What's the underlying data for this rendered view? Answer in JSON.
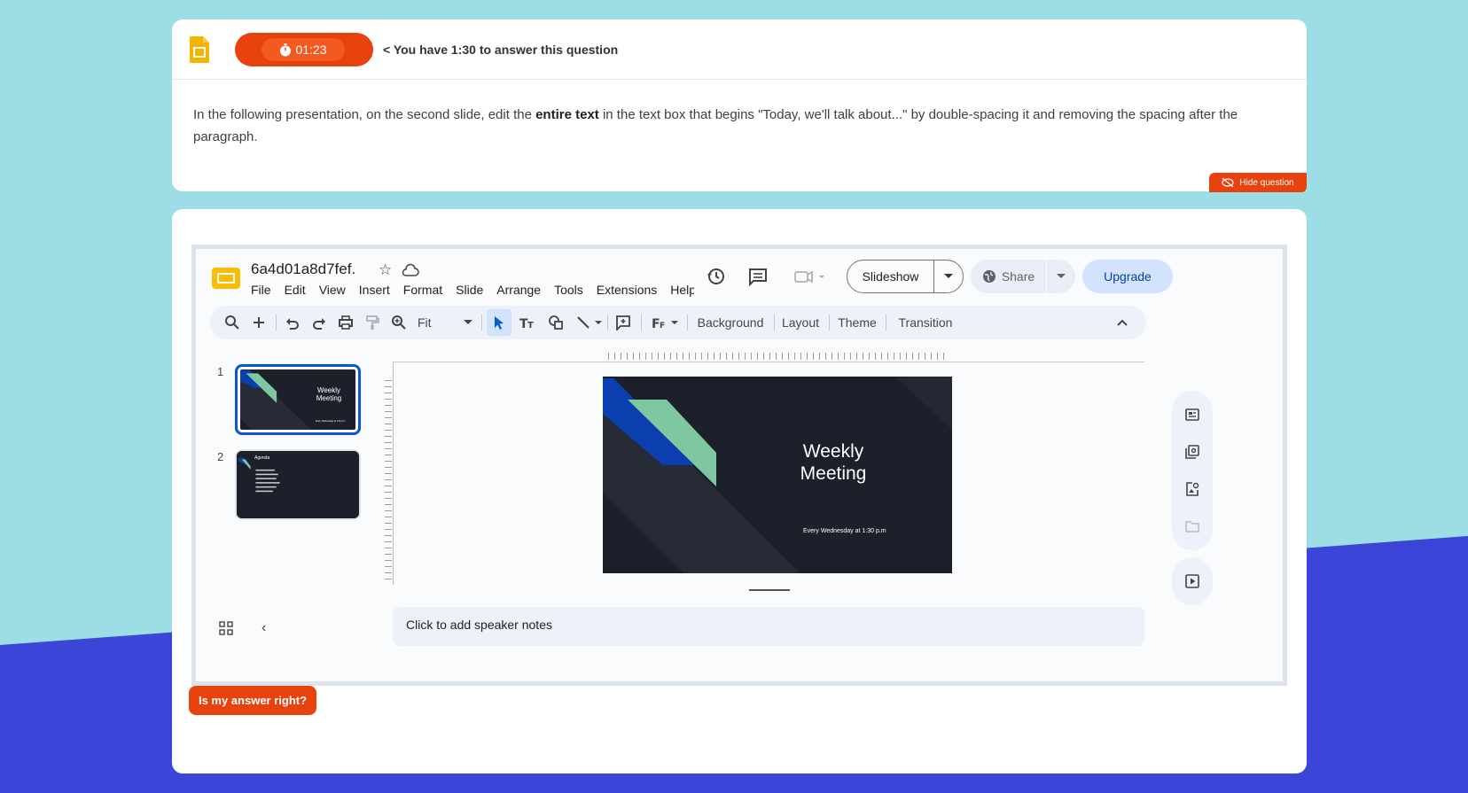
{
  "colors": {
    "accent": "#e8430f",
    "bg_top": "#9ddde6",
    "bg_bottom": "#3b46d9",
    "slide_bg": "#1c202a",
    "slide_green": "#7fc7a0",
    "slide_blue": "#0b3fb0"
  },
  "question": {
    "timer": "01:23",
    "timer_hint": "< You have 1:30 to answer this question",
    "text_part1": "In the following presentation, on the second slide, edit the ",
    "text_bold": "entire text",
    "text_part2": " in the text box that begins \"Today, we'll talk about...\" by double-spacing it and removing the spacing after the paragraph.",
    "hide_label": "Hide question"
  },
  "slides_app": {
    "doc_title": "6a4d01a8d7fef.",
    "menu": [
      "File",
      "Edit",
      "View",
      "Insert",
      "Format",
      "Slide",
      "Arrange",
      "Tools",
      "Extensions",
      "Help"
    ],
    "slideshow_label": "Slideshow",
    "share_label": "Share",
    "upgrade_label": "Upgrade",
    "toolbar": {
      "zoom": "Fit",
      "background": "Background",
      "layout": "Layout",
      "theme": "Theme",
      "transition": "Transition"
    },
    "filmstrip": [
      {
        "number": "1",
        "title": "Weekly Meeting",
        "subtitle": "Every Wednesday at 1:30 p.m"
      },
      {
        "number": "2",
        "title": "Agenda"
      }
    ],
    "current_slide": {
      "title_line1": "Weekly",
      "title_line2": "Meeting",
      "subtitle": "Every Wednesday at 1:30 p.m"
    },
    "speaker_notes_placeholder": "Click to add speaker notes"
  },
  "check_answer_label": "Is my answer right?"
}
